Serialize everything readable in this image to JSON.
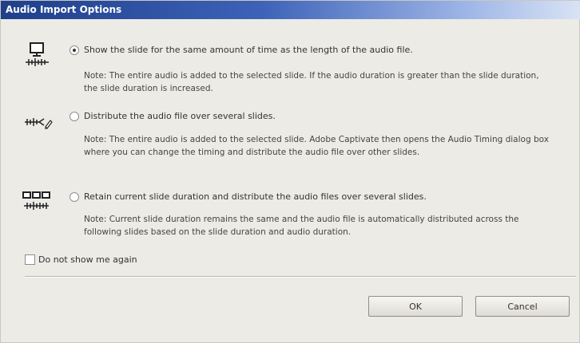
{
  "window": {
    "title": "Audio Import Options"
  },
  "options": [
    {
      "label": "Show the slide for the same amount of time as the length of the audio file.",
      "selected": true,
      "icon": "slide-with-audio-icon",
      "note": "Note: The entire audio is added to the selected slide. If the audio duration is greater than the slide duration, the slide duration is increased."
    },
    {
      "label": "Distribute the audio file over several slides.",
      "selected": false,
      "icon": "distribute-audio-icon",
      "note": "Note: The entire audio is added to the selected slide. Adobe Captivate then opens the Audio Timing dialog box where you can change the timing and distribute the audio file over other slides."
    },
    {
      "label": "Retain current slide duration and distribute the audio files over several slides.",
      "selected": false,
      "icon": "multiple-slides-audio-icon",
      "note": "Note: Current slide duration remains the same and the audio file is automatically distributed across the following slides based on the slide duration and audio duration."
    }
  ],
  "dont_show": {
    "label": "Do not show me again",
    "checked": false
  },
  "buttons": {
    "ok": "OK",
    "cancel": "Cancel"
  }
}
